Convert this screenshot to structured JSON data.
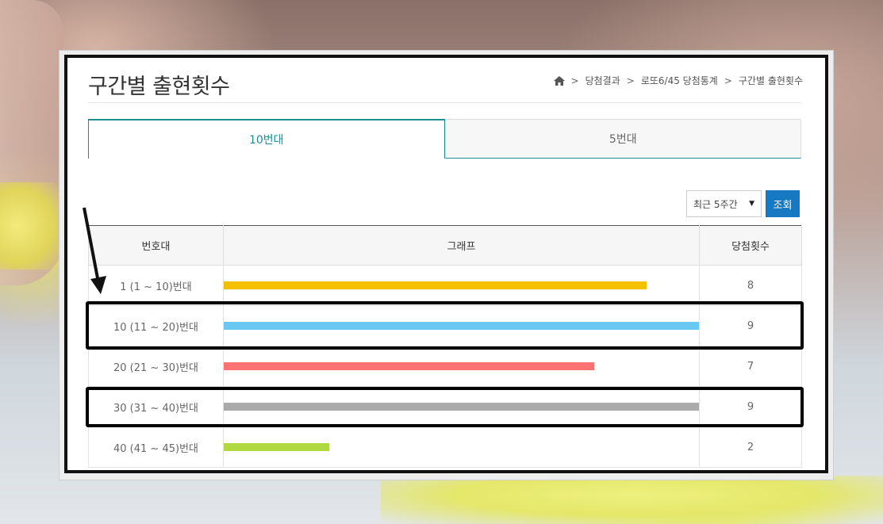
{
  "header": {
    "title": "구간별 출현횟수",
    "breadcrumb": [
      "당첨결과",
      "로또6/45 당첨통계",
      "구간별 출현횟수"
    ],
    "breadcrumb_sep": ">"
  },
  "tabs": [
    {
      "label": "10번대",
      "active": true
    },
    {
      "label": "5번대",
      "active": false
    }
  ],
  "filter": {
    "period_selected": "최근 5주간",
    "query_button": "조회"
  },
  "table": {
    "columns": [
      "번호대",
      "그래프",
      "당첨횟수"
    ],
    "max_count": 9,
    "rows": [
      {
        "range": "1 (1 ~ 10)번대",
        "count": "8",
        "value": 8,
        "color": "#f5c000"
      },
      {
        "range": "10 (11 ~ 20)번대",
        "count": "9",
        "value": 9,
        "color": "#69c8f2"
      },
      {
        "range": "20 (21 ~ 30)번대",
        "count": "7",
        "value": 7,
        "color": "#ff7272"
      },
      {
        "range": "30 (31 ~ 40)번대",
        "count": "9",
        "value": 9,
        "color": "#aaaaaa"
      },
      {
        "range": "40 (41 ~ 45)번대",
        "count": "2",
        "value": 2,
        "color": "#b0d840"
      }
    ]
  },
  "colors": {
    "accent": "#1d8e93",
    "button": "#1679c2"
  }
}
